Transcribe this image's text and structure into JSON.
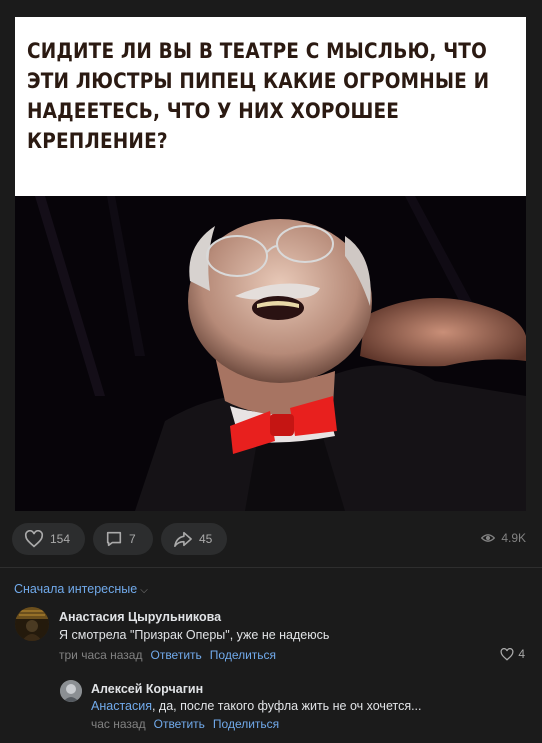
{
  "post": {
    "meme_caption_lines": [
      "СИДИТЕ ЛИ ВЫ В ТЕАТРЕ С МЫСЛЬЮ, ЧТО",
      "ЭТИ ЛЮСТРЫ ПИПЕЦ КАКИЕ ОГРОМНЫЕ И",
      "НАДЕЕТЕСЬ, ЧТО У НИХ ХОРОШЕЕ",
      "КРЕПЛЕНИЕ?"
    ]
  },
  "actions": {
    "likes": "154",
    "comments": "7",
    "shares": "45",
    "views": "4.9K"
  },
  "comments_section": {
    "sort_label": "Сначала интересные",
    "comments": [
      {
        "author": "Анастасия Цырульникова",
        "text": "Я смотрела \"Призрак Оперы\", уже не надеюсь",
        "time": "три часа назад",
        "reply_label": "Ответить",
        "share_label": "Поделиться",
        "likes": "4"
      }
    ],
    "replies": [
      {
        "author": "Алексей Корчагин",
        "mention": "Анастасия",
        "text": ", да, после такого фуфла жить не оч хочется...",
        "time": "час назад",
        "reply_label": "Ответить",
        "share_label": "Поделиться"
      }
    ]
  },
  "colors": {
    "background": "#1b1b1b",
    "link": "#71aaeb",
    "pill": "#2c2d2e",
    "bow_tie": "#e8201e"
  },
  "icons": [
    "heart-icon",
    "comment-icon",
    "share-icon",
    "eye-icon",
    "chevron-down-icon"
  ]
}
